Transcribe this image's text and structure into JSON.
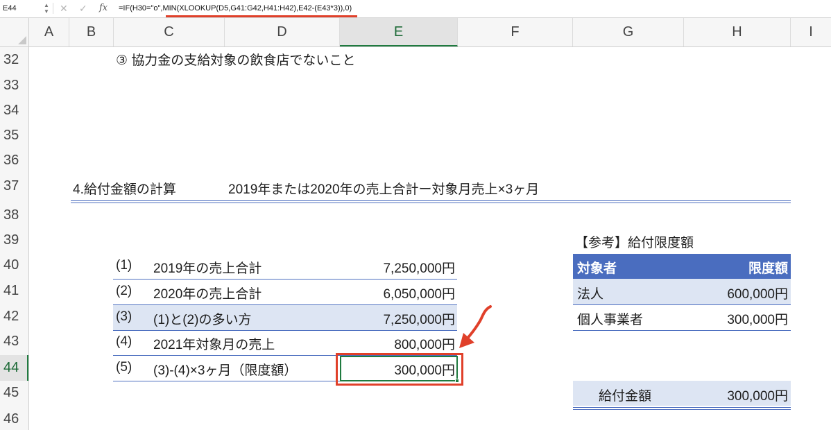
{
  "formula_bar": {
    "name_box": "E44",
    "formula": "=IF(H30=\"o\",MIN(XLOOKUP(D5,G41:G42,H41:H42),E42-(E43*3)),0)",
    "icons": [
      "cancel-icon",
      "enter-icon",
      "fx-icon"
    ]
  },
  "columns": [
    "A",
    "B",
    "C",
    "D",
    "E",
    "F",
    "G",
    "H",
    "I"
  ],
  "rows": [
    "32",
    "33",
    "34",
    "35",
    "36",
    "37",
    "38",
    "39",
    "40",
    "41",
    "42",
    "43",
    "44",
    "45",
    "46"
  ],
  "selection": {
    "column": "E",
    "row": "44"
  },
  "sheet": {
    "condition_3": "③ 協力金の支給対象の飲食店でないこと",
    "section_title": "4.給付金額の計算",
    "section_formula": "2019年または2020年の売上合計ー対象月売上×3ヶ月",
    "calc_table": [
      {
        "num": "(1)",
        "label": "2019年の売上合計",
        "value": "7,250,000円"
      },
      {
        "num": "(2)",
        "label": "2020年の売上合計",
        "value": "6,050,000円"
      },
      {
        "num": "(3)",
        "label": "(1)と(2)の多い方",
        "value": "7,250,000円"
      },
      {
        "num": "(4)",
        "label": "2021年対象月の売上",
        "value": "800,000円"
      },
      {
        "num": "(5)",
        "label": "(3)-(4)×3ヶ月（限度額）",
        "value": "300,000円"
      }
    ],
    "reference": {
      "title": "【参考】給付限度額",
      "header_target": "対象者",
      "header_limit": "限度額",
      "rows": [
        {
          "target": "法人",
          "limit": "600,000円"
        },
        {
          "target": "個人事業者",
          "limit": "300,000円"
        }
      ]
    },
    "benefit": {
      "label": "給付金額",
      "value": "300,000円"
    }
  },
  "colors": {
    "header_blue": "#4a6dbf",
    "band_blue": "#dde5f3",
    "annotation_red": "#e0402a",
    "selection_green": "#1f7a3f"
  }
}
